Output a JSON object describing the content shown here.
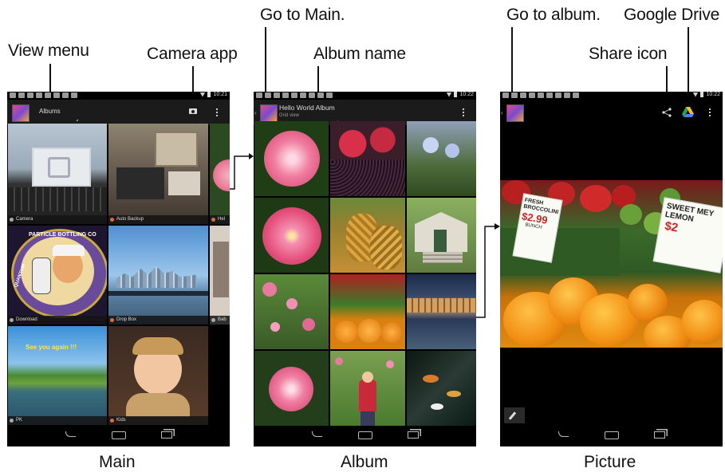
{
  "callouts": {
    "view_menu": "View menu",
    "camera_app": "Camera app",
    "go_to_main": "Go to Main.",
    "album_name": "Album name",
    "go_to_album": "Go to album.",
    "share_icon": "Share icon",
    "google_drive": "Google Drive"
  },
  "captions": {
    "main": "Main",
    "album": "Album",
    "picture": "Picture"
  },
  "status": {
    "time_main": "10:21",
    "time_album": "10:22",
    "time_picture": "10:22"
  },
  "main_screen": {
    "title": "Albums",
    "albums": [
      {
        "name": "Camera",
        "icon": "camera-icon"
      },
      {
        "name": "Auto Backup",
        "icon": "auto-backup-icon"
      },
      {
        "name": "Hel",
        "icon": "album-icon"
      },
      {
        "name": "Download",
        "icon": "folder-icon"
      },
      {
        "name": "Drop Box",
        "icon": "dropbox-icon"
      },
      {
        "name": "Bab",
        "icon": "album-icon"
      },
      {
        "name": "PK",
        "icon": "folder-icon"
      },
      {
        "name": "Kids",
        "icon": "album-icon"
      }
    ],
    "download_art_text": "PARTICLE BOTTLING CO",
    "download_art_left": "QUANTUM",
    "pk_text": "See you again !!!"
  },
  "album_screen": {
    "title": "Hello World Album",
    "subtitle": "Grid view"
  },
  "picture_screen": {
    "sign_fresh": "FRESH BROCCOLINI",
    "sign_price": "$2.99",
    "sign_bunch": "BUNCH",
    "sign_sweet": "SWEET MEY LEMON",
    "sign_price2": "$2"
  },
  "icons": {
    "share": "share-icon",
    "drive": "google-drive-icon",
    "camera": "camera-icon",
    "overflow": "overflow-menu-icon",
    "edit": "pencil-icon"
  }
}
